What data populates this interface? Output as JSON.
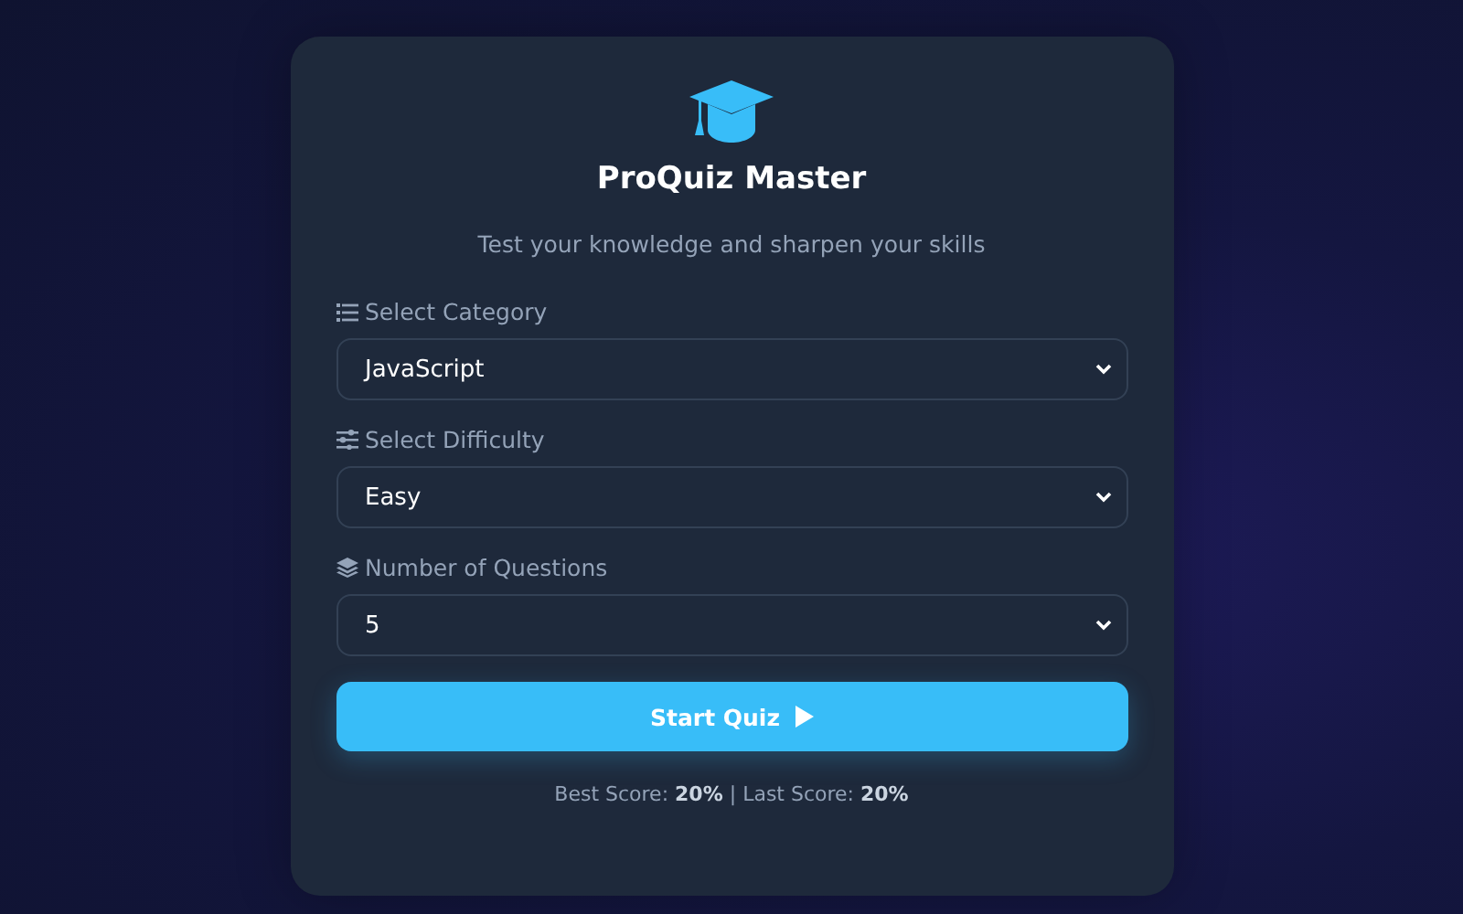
{
  "app": {
    "title": "ProQuiz Master",
    "subtitle": "Test your knowledge and sharpen your skills"
  },
  "fields": [
    {
      "label": "Select Category",
      "value": "JavaScript"
    },
    {
      "label": "Select Difficulty",
      "value": "Easy"
    },
    {
      "label": "Number of Questions",
      "value": "5"
    }
  ],
  "start_button": {
    "label": "Start Quiz"
  },
  "scores": "Best Score: **20%** | Last Score: **20%**"
}
